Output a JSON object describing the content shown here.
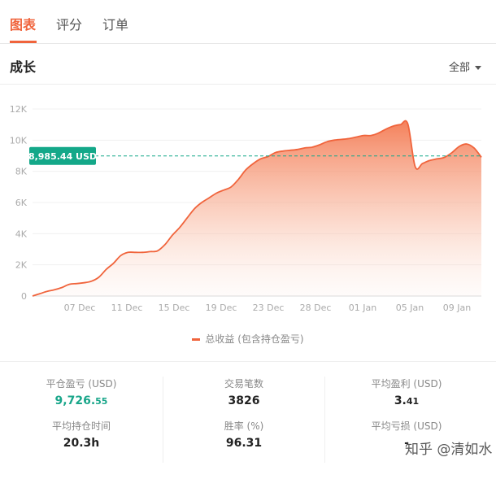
{
  "tabs": [
    {
      "label": "图表",
      "active": true
    },
    {
      "label": "评分",
      "active": false
    },
    {
      "label": "订单",
      "active": false
    }
  ],
  "section": {
    "title": "成长",
    "filter": "全部"
  },
  "chart_data": {
    "type": "area",
    "title": "",
    "xlabel": "",
    "ylabel": "",
    "ylim": [
      0,
      12000
    ],
    "y_ticks": [
      0,
      2000,
      4000,
      6000,
      8000,
      10000,
      12000
    ],
    "y_tick_labels": [
      "0",
      "2K",
      "4K",
      "6K",
      "8K",
      "10K",
      "12K"
    ],
    "x_ticks": [
      "07 Dec",
      "11 Dec",
      "15 Dec",
      "19 Dec",
      "23 Dec",
      "28 Dec",
      "01 Jan",
      "05 Jan",
      "09 Jan"
    ],
    "grid": true,
    "legend_position": "bottom-center",
    "reference_line": {
      "value": 8985.44,
      "label": "8,985.44 USD",
      "color": "#14a889"
    },
    "series": [
      {
        "name": "总收益 (包含持仓盈亏)",
        "color": "#f0643c",
        "values": [
          0,
          150,
          300,
          400,
          550,
          750,
          800,
          850,
          950,
          1200,
          1700,
          2100,
          2600,
          2800,
          2800,
          2800,
          2850,
          2900,
          3300,
          3900,
          4400,
          5000,
          5600,
          6000,
          6300,
          6600,
          6800,
          7000,
          7500,
          8100,
          8500,
          8800,
          8950,
          9200,
          9300,
          9350,
          9400,
          9500,
          9550,
          9700,
          9900,
          10000,
          10050,
          10100,
          10200,
          10300,
          10300,
          10450,
          10700,
          10900,
          11000,
          11050,
          8300,
          8500,
          8700,
          8800,
          8900,
          9200,
          9600,
          9750,
          9500,
          8900
        ]
      }
    ]
  },
  "legend": {
    "label": "总收益 (包含持仓盈亏)"
  },
  "stats": [
    [
      {
        "label": "平仓盈亏 (USD)",
        "value_main": "9,726.",
        "value_small": "55",
        "green": true
      },
      {
        "label": "平均持仓时间",
        "value_main": "20.3h",
        "value_small": ""
      }
    ],
    [
      {
        "label": "交易笔数",
        "value_main": "3826",
        "value_small": ""
      },
      {
        "label": "胜率 (%)",
        "value_main": "96.31",
        "value_small": ""
      }
    ],
    [
      {
        "label": "平均盈利 (USD)",
        "value_main": "3.",
        "value_small": "41"
      },
      {
        "label": "平均亏损 (USD)",
        "value_main": "-",
        "value_small": ""
      }
    ]
  ],
  "watermark": "知乎 @清如水"
}
